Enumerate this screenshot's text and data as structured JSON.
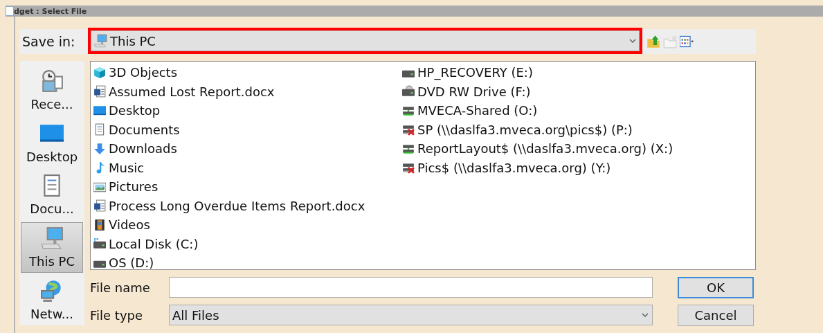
{
  "window": {
    "title": "dget : Select File"
  },
  "save_in": {
    "label": "Save in:",
    "value": "This PC",
    "highlighted": true
  },
  "toolbar": [
    {
      "kind": "up"
    },
    {
      "kind": "new-folder",
      "disabled": true
    },
    {
      "kind": "view"
    }
  ],
  "places": [
    {
      "label": "Rece...",
      "kind": "recent",
      "selected": false
    },
    {
      "label": "Desktop",
      "kind": "desktop",
      "selected": false
    },
    {
      "label": "Docu...",
      "kind": "documents",
      "selected": false
    },
    {
      "label": "This PC",
      "kind": "pc",
      "selected": true
    },
    {
      "label": "Netw...",
      "kind": "network",
      "selected": false
    }
  ],
  "files": [
    {
      "name": "3D Objects",
      "kind": "cube"
    },
    {
      "name": "Assumed Lost Report.docx",
      "kind": "docx"
    },
    {
      "name": "Desktop",
      "kind": "desktop"
    },
    {
      "name": "Documents",
      "kind": "documents"
    },
    {
      "name": "Downloads",
      "kind": "downloads"
    },
    {
      "name": "Music",
      "kind": "music"
    },
    {
      "name": "Pictures",
      "kind": "pictures"
    },
    {
      "name": "Process Long Overdue Items Report.docx",
      "kind": "docx"
    },
    {
      "name": "Videos",
      "kind": "videos"
    },
    {
      "name": "Local Disk (C:)",
      "kind": "system-disk"
    },
    {
      "name": "OS (D:)",
      "kind": "disk"
    },
    {
      "name": "HP_RECOVERY (E:)",
      "kind": "disk"
    },
    {
      "name": "DVD RW Drive (F:)",
      "kind": "dvd"
    },
    {
      "name": "MVECA-Shared (O:)",
      "kind": "network-drive"
    },
    {
      "name": "SP (\\\\daslfa3.mveca.org\\pics$) (P:)",
      "kind": "network-drive-off"
    },
    {
      "name": "ReportLayout$ (\\\\daslfa3.mveca.org) (X:)",
      "kind": "network-drive"
    },
    {
      "name": "Pics$ (\\\\daslfa3.mveca.org) (Y:)",
      "kind": "network-drive-off"
    }
  ],
  "file_name": {
    "label": "File name"
  },
  "file_type": {
    "label": "File type",
    "value": "All Files"
  },
  "buttons": [
    {
      "label": "OK",
      "default": true
    },
    {
      "label": "Cancel",
      "default": false
    }
  ]
}
